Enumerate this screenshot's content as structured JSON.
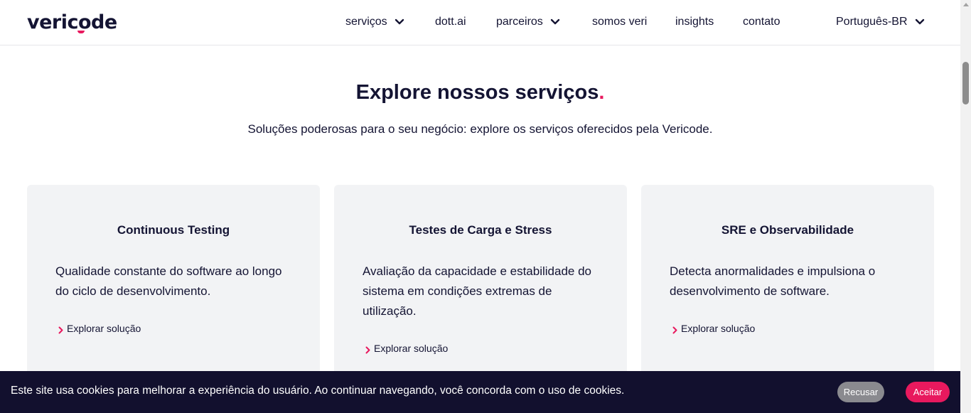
{
  "header": {
    "logo_text": "vericode",
    "nav": [
      {
        "label": "serviços",
        "dropdown": true
      },
      {
        "label": "dott.ai",
        "dropdown": false
      },
      {
        "label": "parceiros",
        "dropdown": true
      },
      {
        "label": "somos veri",
        "dropdown": false
      },
      {
        "label": "insights",
        "dropdown": false
      },
      {
        "label": "contato",
        "dropdown": false
      }
    ],
    "language": "Português-BR"
  },
  "hero": {
    "title": "Explore nossos serviços",
    "title_dot": ".",
    "subtitle": "Soluções poderosas para o seu negócio: explore os serviços oferecidos pela Vericode."
  },
  "cards": [
    {
      "title": "Continuous Testing",
      "description": "Qualidade constante do software ao longo do ciclo de desenvolvimento.",
      "link": "Explorar solução"
    },
    {
      "title": "Testes de Carga e Stress",
      "description": "Avaliação da capacidade e estabilidade do sistema em condições extremas de utilização.",
      "link": "Explorar solução"
    },
    {
      "title": "SRE e Observabilidade",
      "description": "Detecta anormalidades e impulsiona o desenvolvimento de software.",
      "link": "Explorar solução"
    }
  ],
  "cookie": {
    "text": "Este site usa cookies para melhorar a experiência do usuário. Ao continuar navegando, você concorda com o uso de cookies.",
    "reject_label": "Recusar",
    "accept_label": "Aceitar"
  },
  "colors": {
    "accent": "#e8195e",
    "text": "#141433",
    "card_bg": "#f2f3f5",
    "banner_bg": "#12102e"
  },
  "icons": [
    "chevron-down-icon",
    "chevron-right-icon"
  ]
}
